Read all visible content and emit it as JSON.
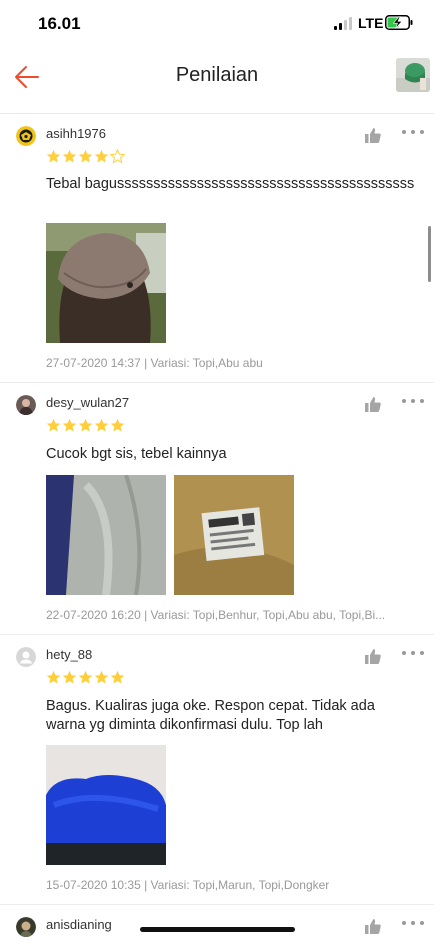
{
  "status": {
    "time": "16.01",
    "network": "LTE"
  },
  "header": {
    "title": "Penilaian"
  },
  "reviews": [
    {
      "username": "asihh1976",
      "rating": 4,
      "text": "Tebal bagusssssssssssssssssssssssssssssssssssssssss",
      "meta": "27-07-2020 14:37 | Variasi: Topi,Abu abu"
    },
    {
      "username": "desy_wulan27",
      "rating": 5,
      "text": "Cucok bgt sis, tebel kainnya",
      "meta": "22-07-2020 16:20 | Variasi: Topi,Benhur, Topi,Abu abu, Topi,Bi..."
    },
    {
      "username": "hety_88",
      "rating": 5,
      "text": "Bagus. Kualiras juga oke. Respon cepat. Tidak ada warna yg diminta dikonfirmasi dulu. Top lah",
      "meta": "15-07-2020 10:35 | Variasi: Topi,Marun, Topi,Dongker"
    },
    {
      "username": "anisdianing"
    }
  ],
  "colors": {
    "accent": "#ee4d2d",
    "star": "#ffce3d",
    "meta": "#999999"
  }
}
